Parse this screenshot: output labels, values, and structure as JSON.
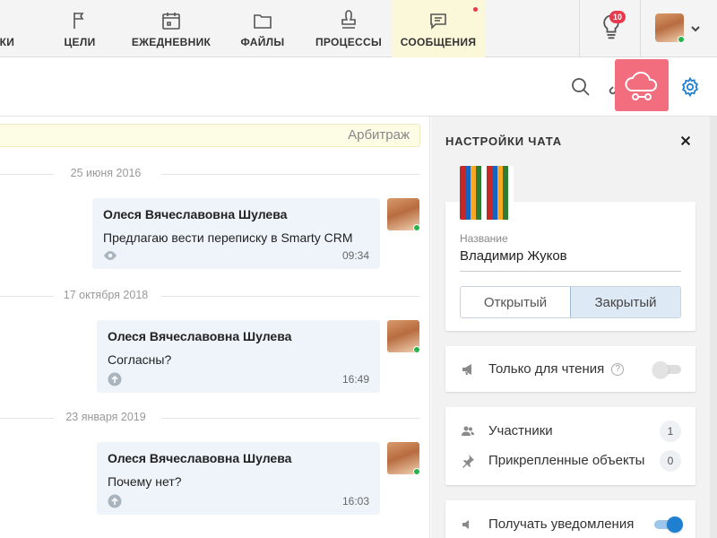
{
  "nav": {
    "items": [
      {
        "label": "ТКИ",
        "icon": "tasks-icon"
      },
      {
        "label": "ЦЕЛИ",
        "icon": "flag-icon"
      },
      {
        "label": "ЕЖЕДНЕВНИК",
        "icon": "calendar-icon"
      },
      {
        "label": "ФАЙЛЫ",
        "icon": "folder-icon"
      },
      {
        "label": "ПРОЦЕССЫ",
        "icon": "stamp-icon"
      },
      {
        "label": "СООБЩЕНИЯ",
        "icon": "chat-icon",
        "active": true
      }
    ],
    "notifications_count": "10",
    "accent_active_bg": "#fbf8d9",
    "badge_color": "#e8394d"
  },
  "toolbar": {
    "icons": [
      "search-icon",
      "link-icon",
      "cloud-icon",
      "gear-icon"
    ],
    "accent_color": "#1f7fd0",
    "overlay_color": "#f26d7d"
  },
  "chat": {
    "deal_label": "Арбитраж",
    "messages": [
      {
        "date": "25 июня 2016",
        "author": "Олеся Вячеславовна Шулева",
        "text": "Предлагаю вести переписку в Smarty CRM",
        "time": "09:34",
        "status_icon": "eye-icon"
      },
      {
        "date": "17 октября 2018",
        "author": "Олеся Вячеславовна Шулева",
        "text": "Согласны?",
        "time": "16:49",
        "status_icon": "sent-arrow-icon"
      },
      {
        "date": "23 января 2019",
        "author": "Олеся Вячеславовна Шулева",
        "text": "Почему нет?",
        "time": "16:03",
        "status_icon": "sent-arrow-icon"
      }
    ],
    "bubble_color": "#eef4fa"
  },
  "settings": {
    "title": "НАСТРОЙКИ ЧАТА",
    "name_label": "Название",
    "name_value": "Владимир Жуков",
    "access_options": [
      "Открытый",
      "Закрытый"
    ],
    "access_selected": "Закрытый",
    "read_only_label": "Только для чтения",
    "read_only_on": false,
    "participants_label": "Участники",
    "participants_count": "1",
    "attached_label": "Прикрепленные объекты",
    "attached_count": "0",
    "notify_label": "Получать уведомления",
    "notify_on": true,
    "help_glyph": "?"
  }
}
